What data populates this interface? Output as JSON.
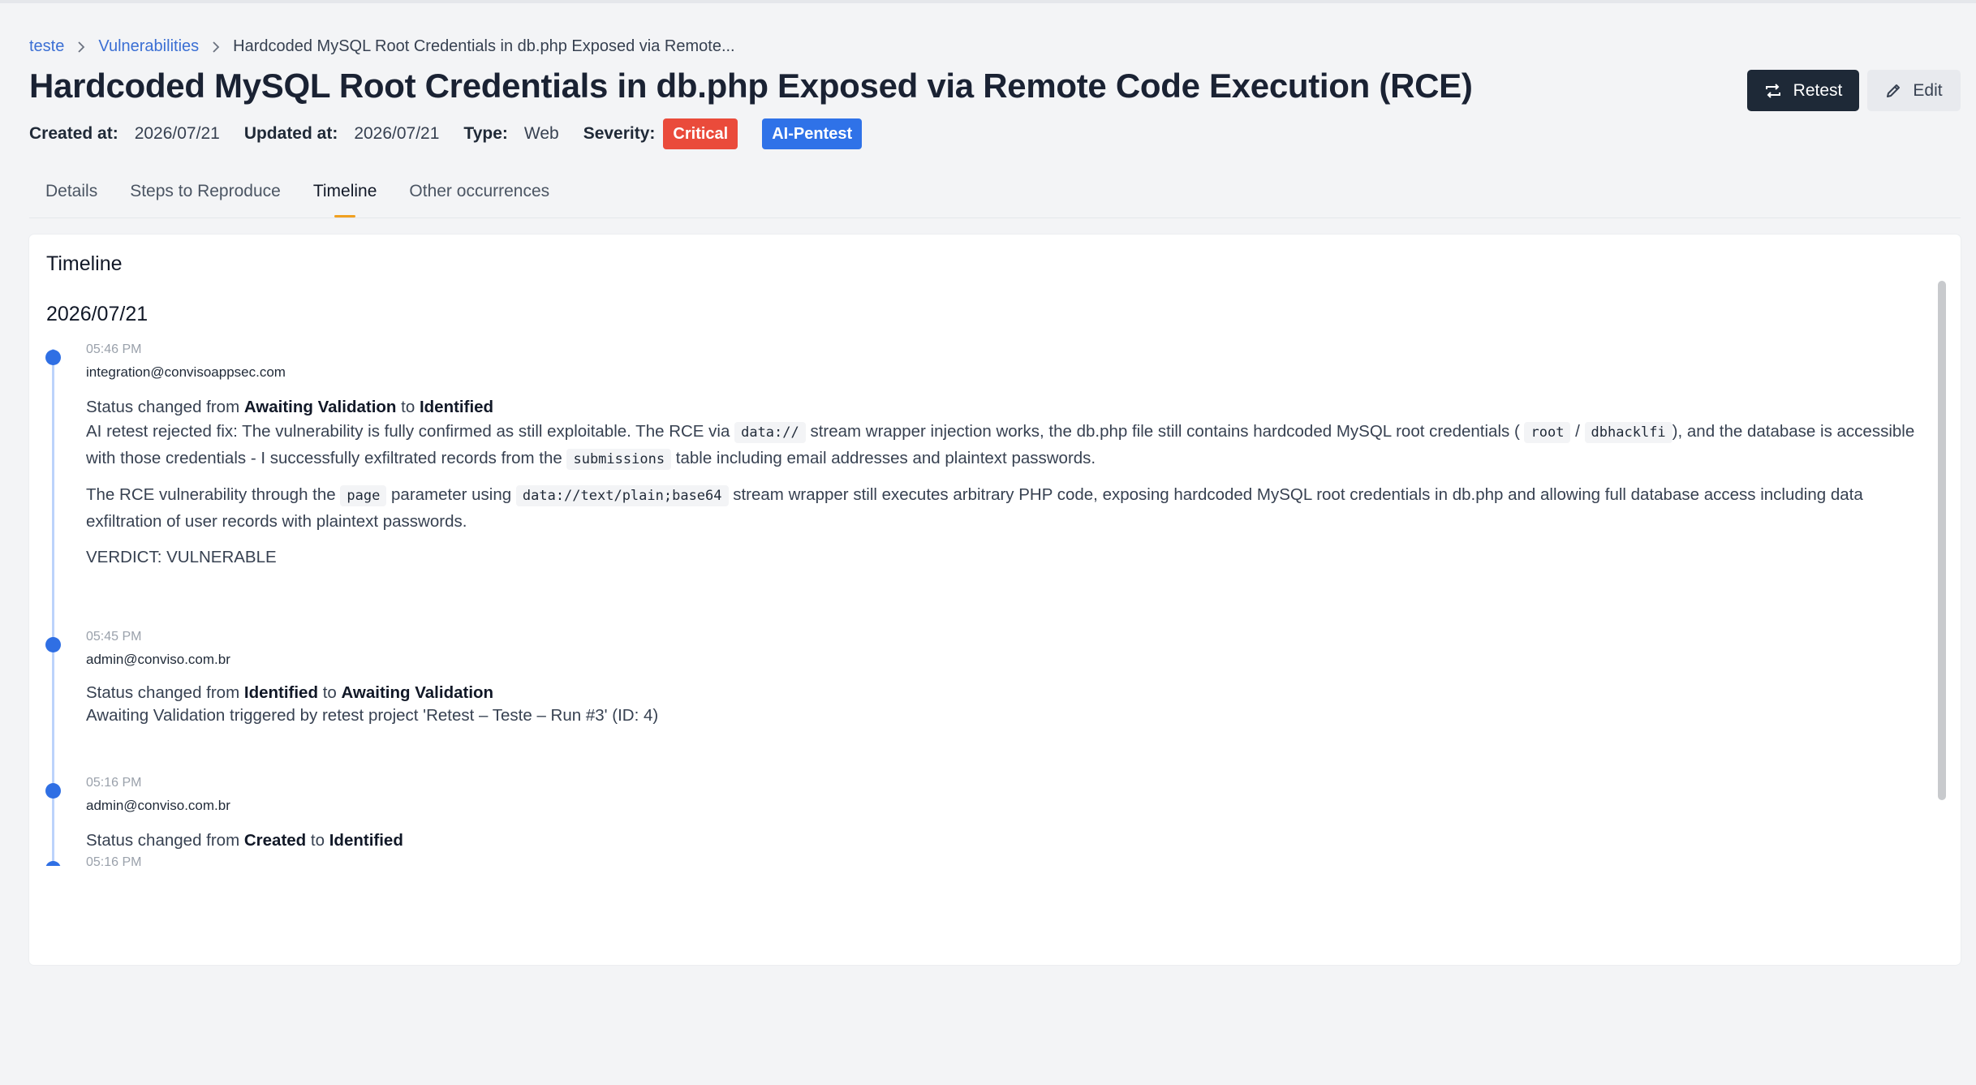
{
  "breadcrumb": {
    "items": [
      "teste",
      "Vulnerabilities"
    ],
    "current": "Hardcoded MySQL Root Credentials in db.php Exposed via Remote..."
  },
  "title": "Hardcoded MySQL Root Credentials in db.php Exposed via Remote Code Execution (RCE)",
  "actions": {
    "retest": "Retest",
    "edit": "Edit"
  },
  "meta": {
    "created_label": "Created at:",
    "created_value": "2026/07/21",
    "updated_label": "Updated at:",
    "updated_value": "2026/07/21",
    "type_label": "Type:",
    "type_value": "Web",
    "severity_label": "Severity:",
    "severity_value": "Critical",
    "tag": "AI-Pentest"
  },
  "tabs": [
    "Details",
    "Steps to Reproduce",
    "Timeline",
    "Other occurrences"
  ],
  "active_tab": "Timeline",
  "timeline": {
    "title": "Timeline",
    "date": "2026/07/21",
    "entries": [
      {
        "time": "05:46 PM",
        "user": "integration@convisoappsec.com",
        "status_prefix": "Status changed from",
        "from": "Awaiting Validation",
        "to_word": "to",
        "to": "Identified",
        "p1_a": "AI retest rejected fix: The vulnerability is fully confirmed as still exploitable. The RCE via",
        "p1_code1": "data://",
        "p1_b": "stream wrapper injection works, the db.php file still contains hardcoded MySQL root credentials (",
        "p1_code2": "root",
        "p1_slash": "/",
        "p1_code3": "dbhacklfi",
        "p1_c": "), and the database is accessible with those credentials - I successfully exfiltrated records from the",
        "p1_code4": "submissions",
        "p1_d": "table including email addresses and plaintext passwords.",
        "p2_a": "The RCE vulnerability through the",
        "p2_code1": "page",
        "p2_b": "parameter using",
        "p2_code2": "data://text/plain;base64",
        "p2_c": "stream wrapper still executes arbitrary PHP code, exposing hardcoded MySQL root credentials in db.php and allowing full database access including data exfiltration of user records with plaintext passwords.",
        "verdict": "VERDICT: VULNERABLE"
      },
      {
        "time": "05:45 PM",
        "user": "admin@conviso.com.br",
        "status_prefix": "Status changed from",
        "from": "Identified",
        "to_word": "to",
        "to": "Awaiting Validation",
        "note": "Awaiting Validation triggered by retest project 'Retest – Teste – Run #3' (ID: 4)"
      },
      {
        "time": "05:16 PM",
        "user": "admin@conviso.com.br",
        "status_prefix": "Status changed from",
        "from": "Created",
        "to_word": "to",
        "to": "Identified"
      },
      {
        "time": "05:16 PM"
      }
    ]
  },
  "colors": {
    "primary_dark": "#1e2937",
    "link": "#3b6fd4",
    "critical": "#ea4b3b",
    "tag": "#2f72e8",
    "timeline_dot": "#2f6fe4",
    "tab_indicator": "#f0a020"
  },
  "icons": [
    "chevron-right-icon",
    "retest-icon",
    "pencil-icon"
  ]
}
